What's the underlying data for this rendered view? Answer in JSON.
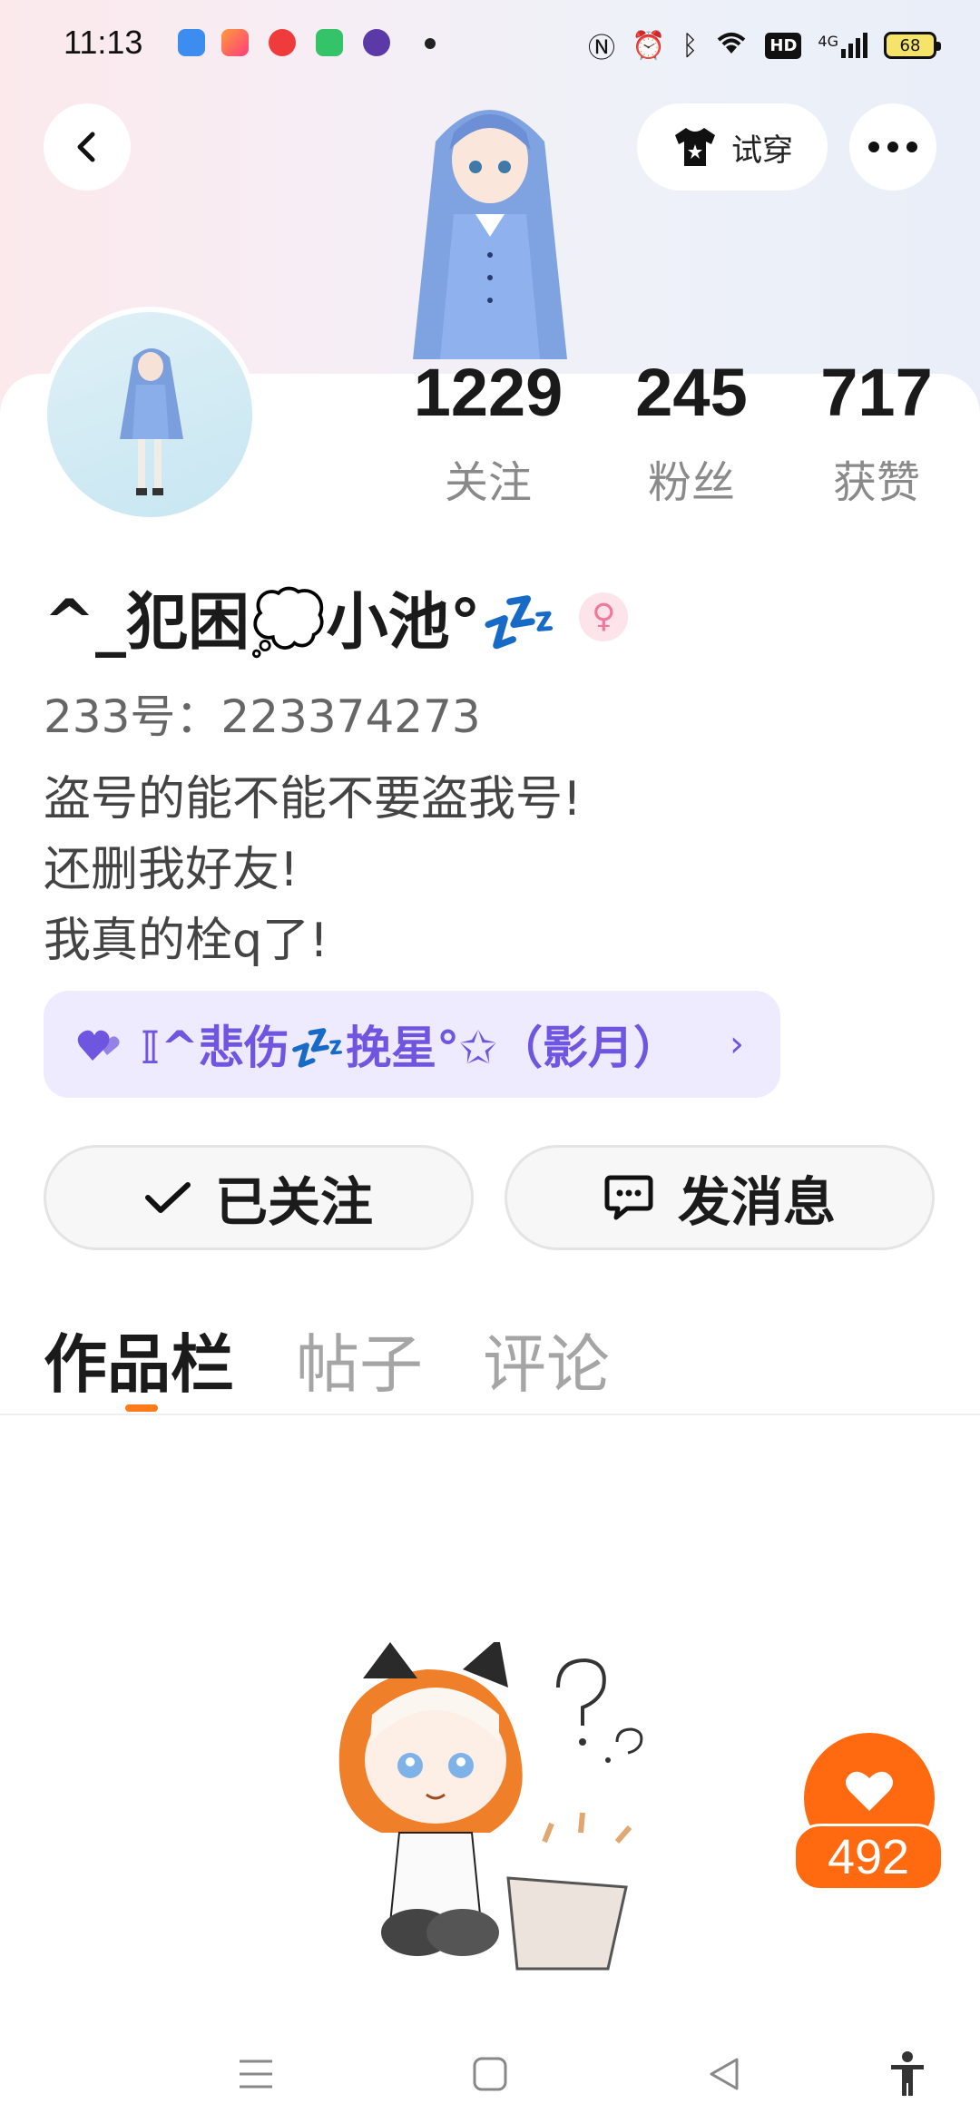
{
  "status_bar": {
    "time": "11:13",
    "battery": "68",
    "network": "4G",
    "hd": "HD"
  },
  "header": {
    "try_on_label": "试穿"
  },
  "profile": {
    "stats": [
      {
        "value": "1229",
        "label": "关注"
      },
      {
        "value": "245",
        "label": "粉丝"
      },
      {
        "value": "717",
        "label": "获赞"
      }
    ],
    "username": "^_犯困💭小池°💤",
    "gender_symbol": "♀",
    "uid": "233号：223374273",
    "bio": [
      "盗号的能不能不要盗我号!",
      "还删我好友!",
      "我真的栓q了!"
    ],
    "group_name": "𝕀^悲伤💤挽星°✩（影月）"
  },
  "actions": {
    "follow_label": "已关注",
    "message_label": "发消息"
  },
  "tabs": [
    {
      "label": "作品栏",
      "active": true
    },
    {
      "label": "帖子",
      "active": false
    },
    {
      "label": "评论",
      "active": false
    }
  ],
  "like_fab": {
    "count": "492"
  },
  "colors": {
    "accent_orange": "#ff6a10",
    "group_purple": "#6e56e0"
  }
}
